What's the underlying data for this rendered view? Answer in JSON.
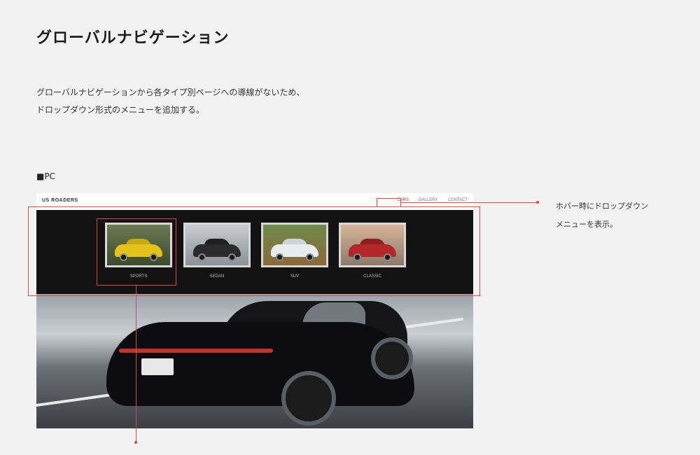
{
  "page": {
    "title": "グローバルナビゲーション",
    "description": [
      "グローバルナビゲーションから各タイプ別ページへの導線がないため、",
      "ドロップダウン形式のメニューを追加する。"
    ],
    "section_label": "■PC",
    "callout": [
      "ホバー時にドロップダウン",
      "メニューを表示。"
    ]
  },
  "mockup": {
    "logo": "US ROADERS",
    "nav": [
      "CARS",
      "GALLERY",
      "CONTACT"
    ],
    "dropdown": [
      {
        "label": "SPORTS",
        "color": "#e3c21a"
      },
      {
        "label": "SEDAN",
        "color": "#2a2a2e"
      },
      {
        "label": "SUV",
        "color": "#e8ecef"
      },
      {
        "label": "CLASSIC",
        "color": "#b3262a"
      }
    ]
  },
  "colors": {
    "accent": "#d84a4a",
    "background": "#f2f2f2",
    "dropdown_bg": "#121212"
  }
}
